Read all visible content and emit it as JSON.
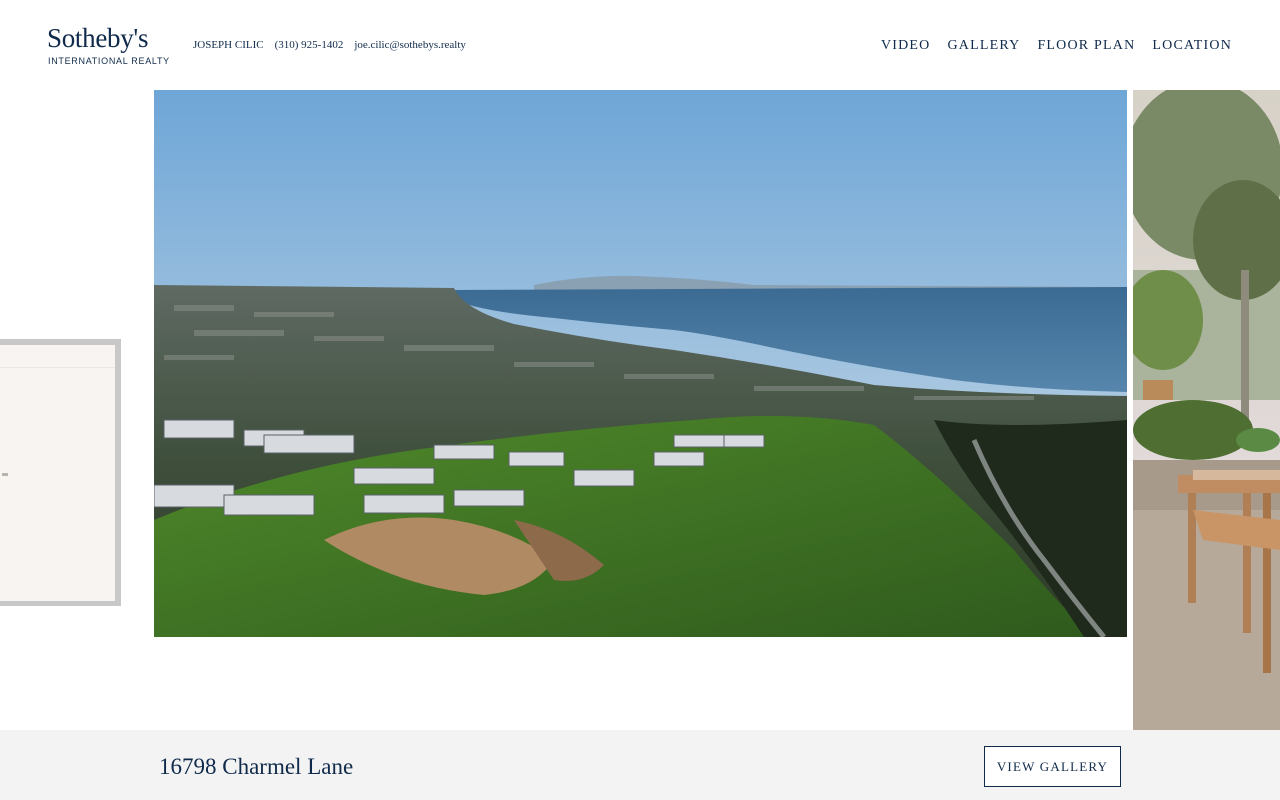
{
  "brand": {
    "name": "Sotheby's",
    "tagline": "INTERNATIONAL REALTY"
  },
  "agent": {
    "name": "JOSEPH CILIC",
    "phone": "(310) 925-1402",
    "email": "joe.cilic@sothebys.realty"
  },
  "nav": {
    "items": [
      {
        "label": "VIDEO"
      },
      {
        "label": "GALLERY"
      },
      {
        "label": "FLOOR PLAN"
      },
      {
        "label": "LOCATION"
      }
    ]
  },
  "listing": {
    "address": "16798 Charmel Lane",
    "gallery_button": "VIEW GALLERY"
  },
  "colors": {
    "brand_navy": "#0f2a4a",
    "footer_bg": "#f3f3f3"
  }
}
